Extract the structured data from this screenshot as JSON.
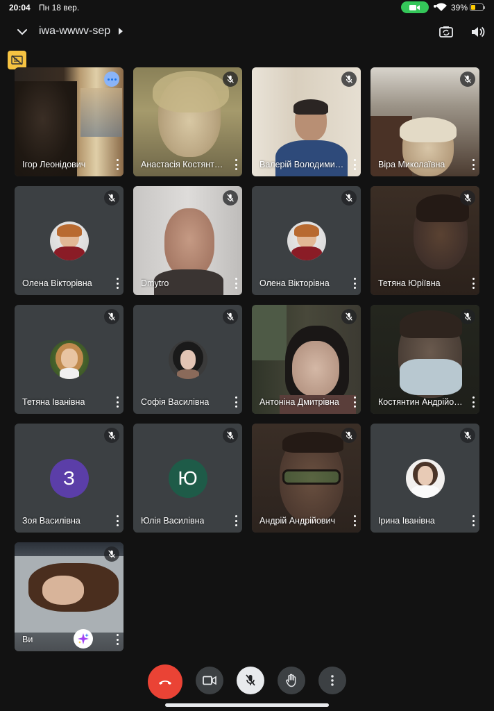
{
  "status_bar": {
    "time": "20:04",
    "date": "Пн 18 вер.",
    "battery": "39%"
  },
  "header": {
    "meeting_code": "iwa-wwwv-sep"
  },
  "tiles": [
    {
      "name": "Ігор Леонідович",
      "type": "video",
      "muted": false
    },
    {
      "name": "Анастасія Костянтинівна",
      "type": "video",
      "muted": true
    },
    {
      "name": "Валерій Володимирович",
      "type": "video",
      "muted": true
    },
    {
      "name": "Віра Миколаївна",
      "type": "video",
      "muted": true
    },
    {
      "name": "Олена Вікторівна",
      "type": "avatar",
      "muted": true
    },
    {
      "name": "Dmytro",
      "type": "video",
      "muted": true
    },
    {
      "name": "Олена Вікторівна",
      "type": "avatar",
      "muted": true
    },
    {
      "name": "Тетяна Юріївна",
      "type": "video",
      "muted": true
    },
    {
      "name": "Тетяна Іванівна",
      "type": "avatar",
      "muted": true
    },
    {
      "name": "Софія Василівна",
      "type": "avatar",
      "muted": true
    },
    {
      "name": "Антоніна Дмитрівна",
      "type": "video",
      "muted": true
    },
    {
      "name": "Костянтин Андрійович",
      "type": "video",
      "muted": true
    },
    {
      "name": "Зоя Василівна",
      "type": "letter",
      "letter": "З",
      "color": "#5b3ea8",
      "muted": true
    },
    {
      "name": "Юлія Василівна",
      "type": "letter",
      "letter": "Ю",
      "color": "#1e5b48",
      "muted": true
    },
    {
      "name": "Андрій Андрійович",
      "type": "video",
      "muted": true
    },
    {
      "name": "Ірина Іванівна",
      "type": "avatar",
      "muted": true
    },
    {
      "name": "Ви",
      "type": "video",
      "muted": true
    }
  ],
  "controls": [
    "end-call",
    "camera",
    "microphone-muted",
    "raise-hand",
    "more-options"
  ],
  "colors": {
    "end_call": "#ea4335",
    "battery": "#ffcc00",
    "camera_active": "#34c759"
  }
}
